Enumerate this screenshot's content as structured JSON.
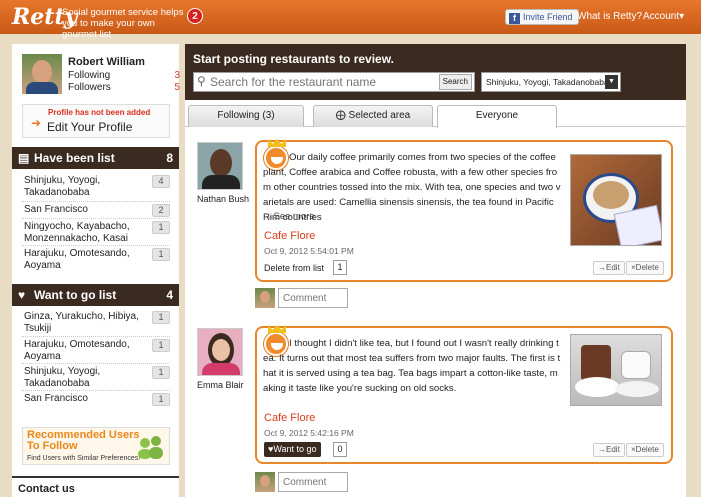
{
  "header": {
    "logo": "Retty",
    "tagline": "Social gourmet service helps you to make your own gourmet list",
    "notification_count": "2",
    "invite_label": "Invite Friend",
    "what_is": "What is Retty?",
    "account": "Account▾"
  },
  "profile": {
    "name": "Robert William",
    "following_label": "Following",
    "following_count": "3",
    "followers_label": "Followers",
    "followers_count": "5",
    "warning": "Profile has not been added",
    "edit_label": "Edit Your Profile"
  },
  "have_been": {
    "title": "Have been list",
    "count": "8",
    "items": [
      {
        "label": "Shinjuku, Yoyogi, Takadanobaba",
        "count": "4"
      },
      {
        "label": "San Francisco",
        "count": "2"
      },
      {
        "label": "Ningyocho, Kayabacho, Monzennakacho, Kasai",
        "count": "1"
      },
      {
        "label": "Harajuku, Omotesando, Aoyama",
        "count": "1"
      }
    ]
  },
  "want_to_go": {
    "title": "Want to go list",
    "count": "4",
    "items": [
      {
        "label": "Ginza, Yurakucho, Hibiya, Tsukiji",
        "count": "1"
      },
      {
        "label": "Harajuku, Omotesando, Aoyama",
        "count": "1"
      },
      {
        "label": "Shinjuku, Yoyogi, Takadanobaba",
        "count": "1"
      },
      {
        "label": "San Francisco",
        "count": "1"
      }
    ]
  },
  "recommended": {
    "title": "Recommended Users To Follow",
    "subtitle": "Find Users with Similar Preferences!"
  },
  "contact": "Contact us",
  "post": {
    "title": "Start posting restaurants to review.",
    "search_placeholder": "Search for the restaurant name",
    "search_button": "Search",
    "area": "Shinjuku, Yoyogi, Takadanobaba"
  },
  "tabs": [
    "Following (3)",
    "Selected area",
    "Everyone"
  ],
  "feed": [
    {
      "user": "Nathan Bush",
      "review": "Our daily coffee primarily comes from two species of the coffee plant, Coffee arabica and Coffee robusta, with a few other species from other countries tossed into the mix. With tea, one species and two varietals are used: Camellia sinensis sinensis, the tea found in Pacific Rim countries",
      "see_more": "→See more",
      "restaurant": "Cafe Flore",
      "date": "Oct 9, 2012 5:54:01 PM",
      "action": "Delete from list",
      "action_count": "1",
      "edit": "→Edit",
      "delete": "×Delete",
      "comment_placeholder": "Comment"
    },
    {
      "user": "Emma Blair",
      "review": "I thought I didn't like tea, but I found out I wasn't really drinking tea. It turns out that most tea suffers from two major faults. The first is that it is served using a tea bag. Tea bags impart a cotton-like taste, making it taste like you're sucking on old socks.",
      "restaurant": "Cafe Flore",
      "date": "Oct 9, 2012 5:42:16 PM",
      "action": "♥Want to go",
      "action_count": "0",
      "edit": "→Edit",
      "delete": "×Delete",
      "comment_placeholder": "Comment"
    }
  ],
  "colors": {
    "accent": "#e8762c",
    "dark": "#3a2a1f",
    "link": "#d8401c"
  }
}
